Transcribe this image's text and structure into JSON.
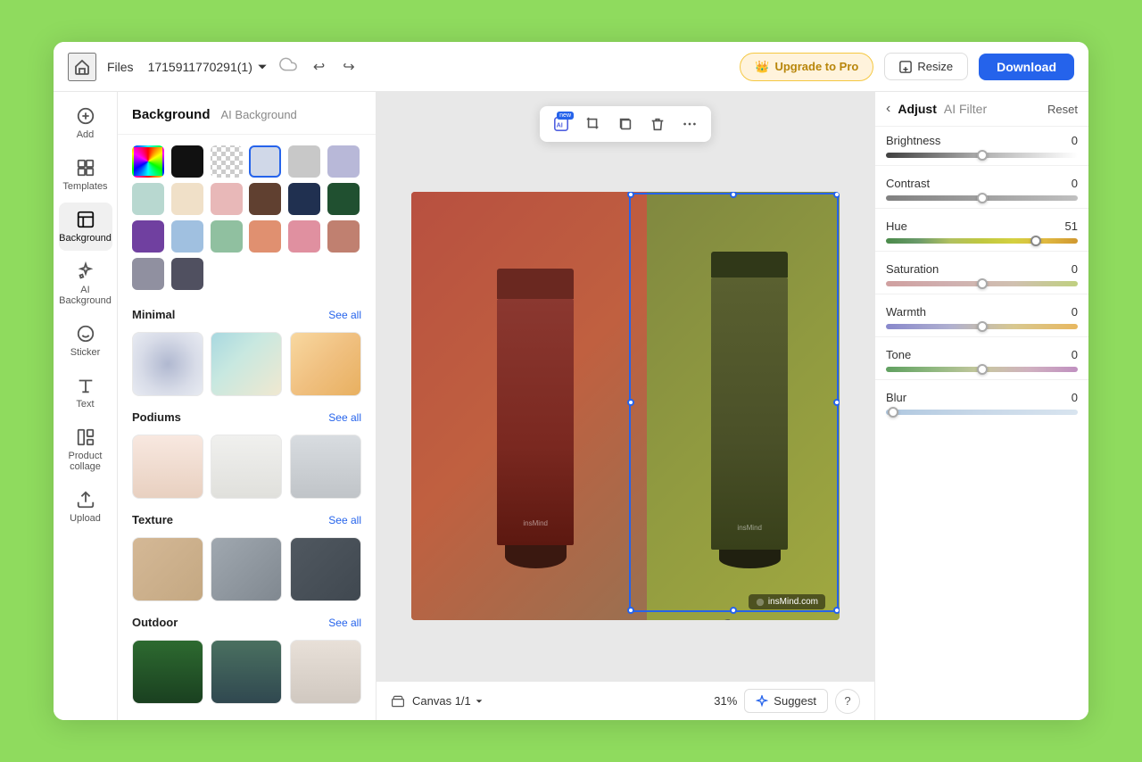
{
  "topBar": {
    "home_label": "Home",
    "files_label": "Files",
    "filename": "1715911770291(1)",
    "upgrade_label": "Upgrade to Pro",
    "resize_label": "Resize",
    "download_label": "Download"
  },
  "sidebar": {
    "items": [
      {
        "id": "add",
        "label": "Add",
        "icon": "plus"
      },
      {
        "id": "templates",
        "label": "Templates",
        "icon": "grid"
      },
      {
        "id": "background",
        "label": "Background",
        "icon": "stripes",
        "active": true
      },
      {
        "id": "ai-background",
        "label": "AI Background",
        "icon": "sparkle"
      },
      {
        "id": "sticker",
        "label": "Sticker",
        "icon": "sticker"
      },
      {
        "id": "text",
        "label": "Text",
        "icon": "text"
      },
      {
        "id": "product-collage",
        "label": "Product collage",
        "icon": "collage"
      },
      {
        "id": "upload",
        "label": "Upload",
        "icon": "upload"
      }
    ]
  },
  "panel": {
    "title": "Background",
    "ai_tab": "AI Background",
    "swatches": [
      {
        "type": "gradient-rainbow",
        "selected": false
      },
      {
        "type": "solid-black",
        "selected": false
      },
      {
        "type": "transparent",
        "selected": false
      },
      {
        "type": "solid-selected",
        "selected": true
      },
      {
        "type": "solid-lightgray",
        "selected": false
      },
      {
        "type": "solid-lavender",
        "selected": false
      },
      {
        "type": "solid-mint",
        "selected": false
      },
      {
        "type": "solid-cream",
        "selected": false
      },
      {
        "type": "solid-blush",
        "selected": false
      },
      {
        "type": "solid-brown",
        "selected": false
      },
      {
        "type": "solid-navy",
        "selected": false
      },
      {
        "type": "solid-forest",
        "selected": false
      },
      {
        "type": "solid-purple",
        "selected": false
      },
      {
        "type": "solid-lightblue",
        "selected": false
      },
      {
        "type": "solid-sage",
        "selected": false
      },
      {
        "type": "solid-peach",
        "selected": false
      },
      {
        "type": "solid-pink",
        "selected": false
      },
      {
        "type": "solid-salmon",
        "selected": false
      },
      {
        "type": "solid-warmgray",
        "selected": false
      },
      {
        "type": "solid-darkgray",
        "selected": false
      }
    ],
    "sections": [
      {
        "id": "minimal",
        "title": "Minimal",
        "see_all": "See all",
        "thumbs": [
          "minimal-1",
          "minimal-2",
          "minimal-3"
        ]
      },
      {
        "id": "podiums",
        "title": "Podiums",
        "see_all": "See all",
        "thumbs": [
          "podium-1",
          "podium-2",
          "podium-3"
        ]
      },
      {
        "id": "texture",
        "title": "Texture",
        "see_all": "See all",
        "thumbs": [
          "texture-1",
          "texture-2",
          "texture-3"
        ]
      },
      {
        "id": "outdoor",
        "title": "Outdoor",
        "see_all": "See all",
        "thumbs": [
          "outdoor-1",
          "outdoor-2",
          "outdoor-3"
        ]
      }
    ]
  },
  "canvas": {
    "label": "Canvas 1/1",
    "zoom": "31%",
    "suggest_label": "Suggest",
    "help_label": "?",
    "watermark": "insMind.com",
    "toolbar": {
      "ai_label": "AI",
      "new_badge": "new"
    }
  },
  "rightPanel": {
    "back_label": "‹",
    "adjust_tab": "Adjust",
    "ai_filter_tab": "AI Filter",
    "reset_label": "Reset",
    "controls": [
      {
        "id": "brightness",
        "label": "Brightness",
        "value": 0,
        "thumb_pct": 50,
        "slider_type": "brightness"
      },
      {
        "id": "contrast",
        "label": "Contrast",
        "value": 0,
        "thumb_pct": 50,
        "slider_type": "contrast"
      },
      {
        "id": "hue",
        "label": "Hue",
        "value": 51,
        "thumb_pct": 78,
        "slider_type": "hue"
      },
      {
        "id": "saturation",
        "label": "Saturation",
        "value": 0,
        "thumb_pct": 50,
        "slider_type": "saturation"
      },
      {
        "id": "warmth",
        "label": "Warmth",
        "value": 0,
        "thumb_pct": 50,
        "slider_type": "warmth"
      },
      {
        "id": "tone",
        "label": "Tone",
        "value": 0,
        "thumb_pct": 50,
        "slider_type": "tone"
      },
      {
        "id": "blur",
        "label": "Blur",
        "value": 0,
        "thumb_pct": 2,
        "slider_type": "blur"
      }
    ]
  }
}
